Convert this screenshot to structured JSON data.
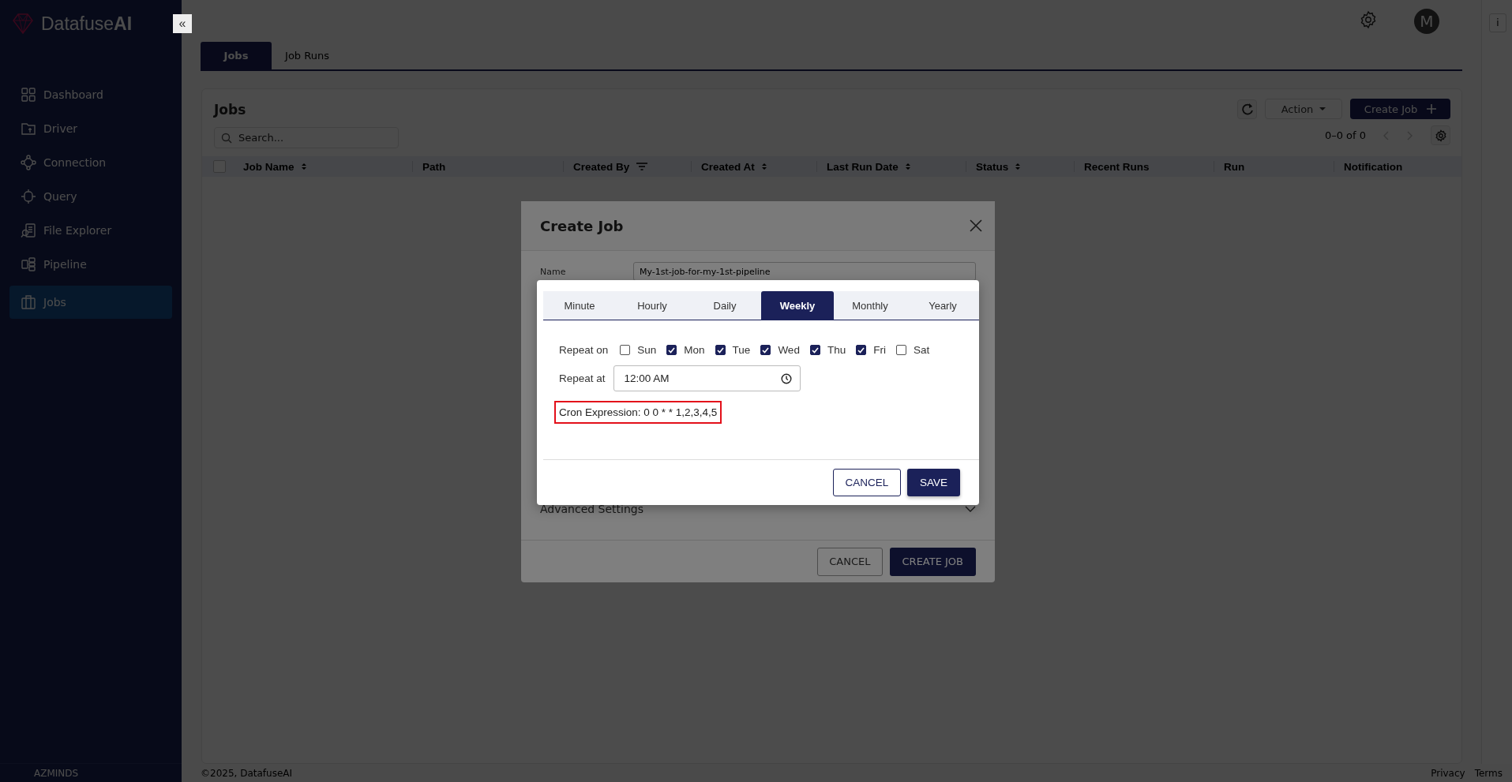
{
  "sidebar": {
    "logo": "Datafuse**AI**",
    "items": [
      {
        "label": "Dashboard",
        "selected": false
      },
      {
        "label": "Driver",
        "selected": false
      },
      {
        "label": "Connection",
        "selected": false
      },
      {
        "label": "Query",
        "selected": false
      },
      {
        "label": "File Explorer",
        "selected": false
      },
      {
        "label": "Pipeline",
        "selected": false
      },
      {
        "label": "Jobs",
        "selected": true
      }
    ],
    "footer": "AZMINDS",
    "collapse": "«"
  },
  "header": {
    "avatar": "M",
    "info": "i"
  },
  "tabs": [
    {
      "label": "Jobs",
      "selected": true
    },
    {
      "label": "Job Runs",
      "selected": false
    }
  ],
  "card": {
    "title": "Jobs",
    "select_all": {
      "checked": false
    },
    "search": {
      "placeholder": "Search..."
    },
    "action": "Action",
    "create": "Create Job",
    "pagination": "0–0 of 0",
    "columns": [
      {
        "label": "Job Name",
        "kind": "sort"
      },
      {
        "label": "Path",
        "kind": "plain"
      },
      {
        "label": "Created By",
        "kind": "filter"
      },
      {
        "label": "Created At",
        "kind": "sort"
      },
      {
        "label": "Last Run Date",
        "kind": "sort"
      },
      {
        "label": "Status",
        "kind": "sort"
      },
      {
        "label": "Recent Runs",
        "kind": "plain"
      },
      {
        "label": "Run",
        "kind": "plain"
      },
      {
        "label": "Notification",
        "kind": "plain"
      }
    ]
  },
  "footer": {
    "copyright": "©2025, DatafuseAI",
    "links": [
      "Privacy",
      "Terms"
    ]
  },
  "dialog": {
    "title": "Create Job",
    "name_label": "Name",
    "name_value": "My-1st-job-for-my-1st-pipeline",
    "advanced": "Advanced Settings",
    "buttons": [
      "CANCEL",
      "CREATE JOB"
    ]
  },
  "schedule": {
    "tabs": [
      {
        "label": "Minute",
        "selected": false
      },
      {
        "label": "Hourly",
        "selected": false
      },
      {
        "label": "Daily",
        "selected": false
      },
      {
        "label": "Weekly",
        "selected": true
      },
      {
        "label": "Monthly",
        "selected": false
      },
      {
        "label": "Yearly",
        "selected": false
      }
    ],
    "repeat_on": "Repeat on",
    "days": [
      {
        "label": "Sun",
        "checked": false
      },
      {
        "label": "Mon",
        "checked": true
      },
      {
        "label": "Tue",
        "checked": true
      },
      {
        "label": "Wed",
        "checked": true
      },
      {
        "label": "Thu",
        "checked": true
      },
      {
        "label": "Fri",
        "checked": true
      },
      {
        "label": "Sat",
        "checked": false
      }
    ],
    "repeat_at": "Repeat at",
    "time": "12:00 AM",
    "cron": "Cron Expression: 0 0 * * 1,2,3,4,5",
    "buttons": [
      "CANCEL",
      "SAVE"
    ]
  }
}
